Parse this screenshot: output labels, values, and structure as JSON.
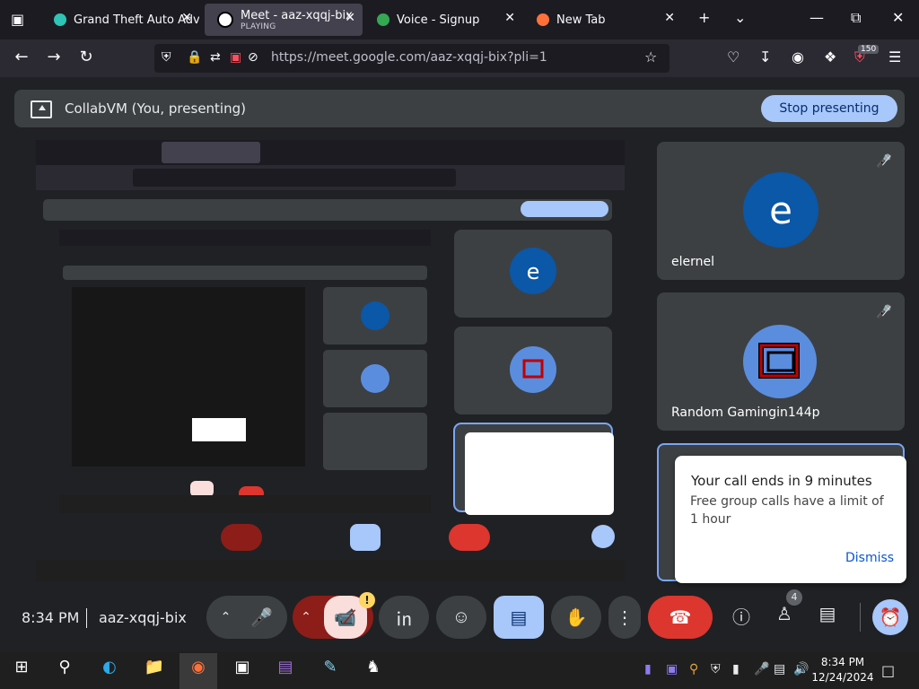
{
  "browser": {
    "tabs": [
      {
        "title": "Grand Theft Auto Adve",
        "subtitle": ""
      },
      {
        "title": "Meet - aaz-xqqj-bix",
        "subtitle": "PLAYING"
      },
      {
        "title": "Voice - Signup",
        "subtitle": ""
      },
      {
        "title": "New Tab",
        "subtitle": ""
      }
    ],
    "url": "https://meet.google.com/aaz-xqqj-bix?pli=1",
    "badge_count": "150"
  },
  "meet": {
    "banner_title": "CollabVM (You, presenting)",
    "stop_presenting": "Stop presenting",
    "participants": [
      {
        "initial": "e",
        "name": "elernel",
        "avatar_color": "#0b57a8"
      },
      {
        "name": "Random Gamingin144p",
        "avatar_color": "#5b8ddf"
      }
    ],
    "popup": {
      "title": "Your call ends in 9 minutes",
      "body": "Free group calls have a limit of 1 hour",
      "dismiss": "Dismiss"
    },
    "time": "8:34 PM",
    "meeting_code": "aaz-xqqj-bix",
    "people_count": "4",
    "camera_warning": "!"
  },
  "taskbar": {
    "time": "8:34 PM",
    "date": "12/24/2024"
  },
  "colors": {
    "end_call": "#dc362e",
    "present_active": "#a8c7fa",
    "camera_off": "#f9dedc"
  }
}
